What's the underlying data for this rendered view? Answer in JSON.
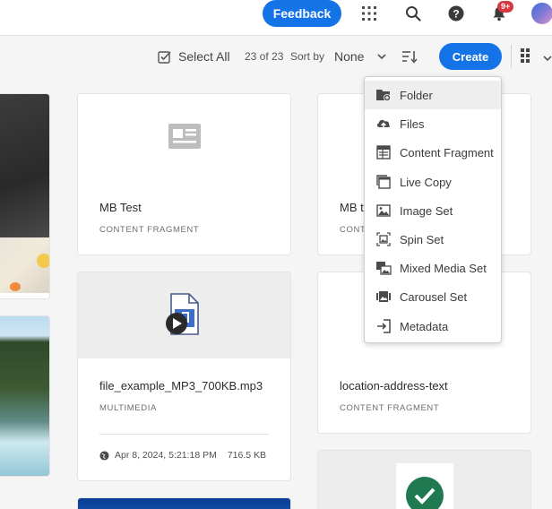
{
  "topbar": {
    "feedback_label": "Feedback",
    "notification_badge": "9+",
    "icons": [
      "apps-grid-icon",
      "search-icon",
      "help-icon",
      "bell-icon",
      "user-avatar"
    ]
  },
  "toolbar": {
    "select_all_label": "Select All",
    "count": "23 of 23",
    "sort_by_label": "Sort by",
    "sort_value": "None",
    "create_label": "Create"
  },
  "cards": [
    {
      "title": "MB Test",
      "type": "CONTENT FRAGMENT"
    },
    {
      "title": "MB te",
      "type": "CONT"
    },
    {
      "title": "file_example_MP3_700KB.mp3",
      "type": "MULTIMEDIA",
      "date": "Apr 8, 2024, 5:21:18 PM",
      "size": "716.5 KB"
    },
    {
      "title": "location-address-text",
      "type": "CONTENT FRAGMENT"
    }
  ],
  "create_menu": {
    "items": [
      {
        "label": "Folder",
        "icon": "folder-add-icon"
      },
      {
        "label": "Files",
        "icon": "cloud-upload-icon"
      },
      {
        "label": "Content Fragment",
        "icon": "content-fragment-icon"
      },
      {
        "label": "Live Copy",
        "icon": "live-copy-icon"
      },
      {
        "label": "Image Set",
        "icon": "image-set-icon"
      },
      {
        "label": "Spin Set",
        "icon": "spin-set-icon"
      },
      {
        "label": "Mixed Media Set",
        "icon": "mixed-media-set-icon"
      },
      {
        "label": "Carousel Set",
        "icon": "carousel-set-icon"
      },
      {
        "label": "Metadata",
        "icon": "metadata-import-icon"
      }
    ]
  },
  "colors": {
    "accent": "#1473e6",
    "badge": "#d7373f",
    "check_green": "#1f7a52",
    "background": "#f5f5f5"
  }
}
